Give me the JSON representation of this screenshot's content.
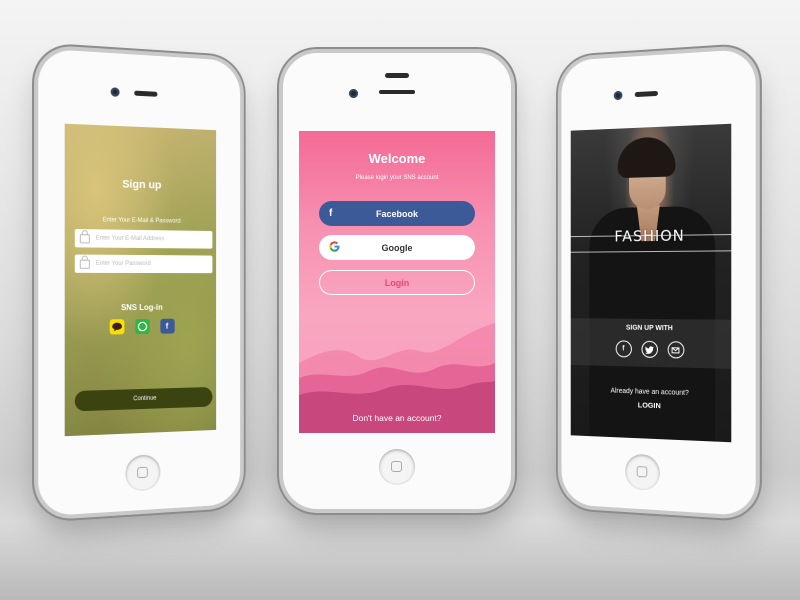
{
  "phone1": {
    "title": "Sign up",
    "subtitle": "Enter Your E-Mail & Password",
    "email_placeholder": "Enter Your E-Mail Address",
    "password_placeholder": "Enter Your Password",
    "sns_label": "SNS Log-in",
    "sns_icons": [
      "kakao-talk-icon",
      "whatsapp-icon",
      "facebook-icon"
    ],
    "continue_label": "Continue",
    "accent": "#3b4310"
  },
  "phone2": {
    "title": "Welcome",
    "subtitle": "Please login your SNS account",
    "facebook_label": "Facebook",
    "google_label": "Google",
    "login_label": "Login",
    "signup_prompt": "Don't have an account?",
    "facebook_color": "#3d5a98",
    "accent": "#e8477a"
  },
  "phone3": {
    "brand": "FASHION",
    "signup_with": "SIGN UP WITH",
    "social_icons": [
      "facebook-icon",
      "twitter-icon",
      "email-icon"
    ],
    "already_prompt": "Already have an account?",
    "login_label": "LOGIN"
  }
}
